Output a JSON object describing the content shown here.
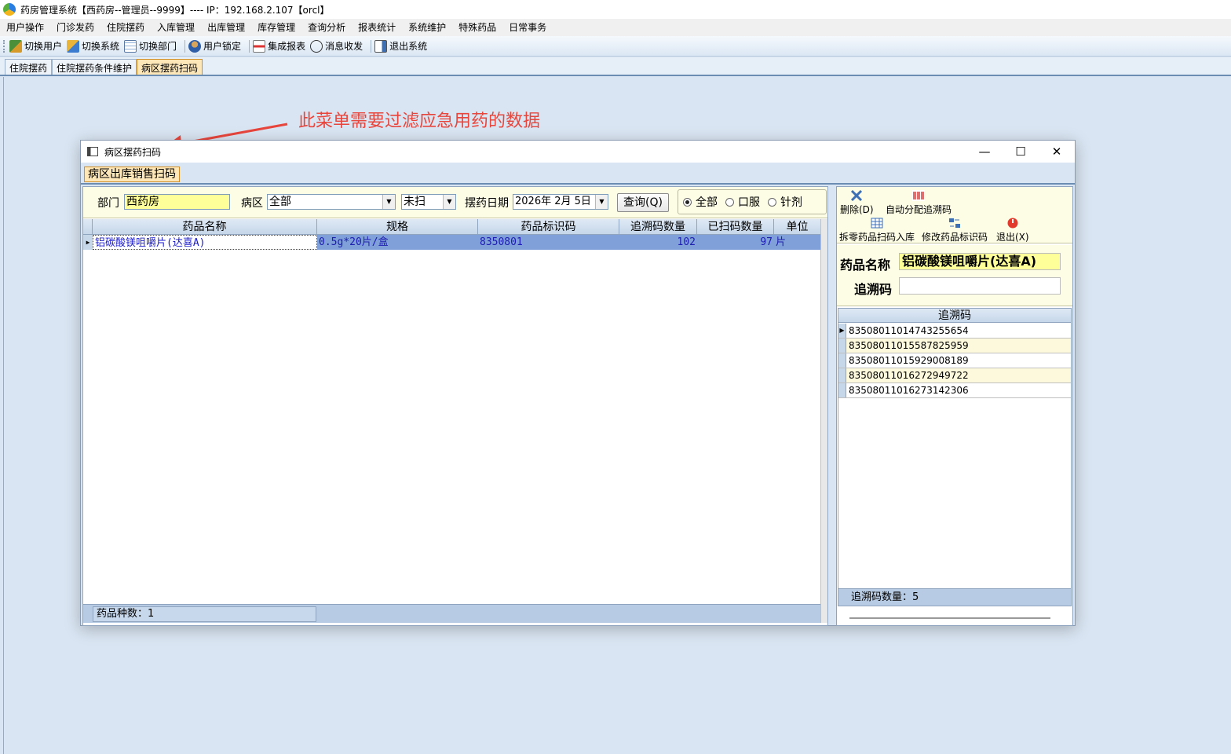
{
  "app": {
    "title": "药房管理系统【西药房--管理员--9999】---- IP：192.168.2.107【orcl】"
  },
  "menu": [
    "用户操作",
    "门诊发药",
    "住院摆药",
    "入库管理",
    "出库管理",
    "库存管理",
    "查询分析",
    "报表统计",
    "系统维护",
    "特殊药品",
    "日常事务"
  ],
  "toolbar": {
    "switch_user": "切换用户",
    "switch_system": "切换系统",
    "switch_dept": "切换部门",
    "lock_user": "用户锁定",
    "integrated_report": "集成报表",
    "messages": "消息收发",
    "exit": "退出系统"
  },
  "tabs": [
    "住院摆药",
    "住院摆药条件维护",
    "病区摆药扫码"
  ],
  "annotation": "此菜单需要过滤应急用药的数据",
  "window": {
    "title": "病区摆药扫码",
    "subtab": "病区出库销售扫码"
  },
  "filters": {
    "dept_label": "部门",
    "dept_value": "西药房",
    "ward_label": "病区",
    "ward_value": "全部",
    "scan_value": "未扫",
    "date_label": "摆药日期",
    "date_value": "2026年  2月  5日",
    "query_button": "查询(Q)",
    "radio_all": "全部",
    "radio_oral": "口服",
    "radio_injection": "针剂"
  },
  "grid": {
    "columns": [
      "药品名称",
      "规格",
      "药品标识码",
      "追溯码数量",
      "已扫码数量",
      "单位"
    ],
    "rows": [
      {
        "name": "铝碳酸镁咀嚼片(达喜A)",
        "spec": "0.5g*20片/盒",
        "code": "8350801",
        "trace_qty": "102",
        "scanned_qty": "97",
        "unit": "片"
      }
    ],
    "footer": "药品种数：1"
  },
  "right": {
    "delete": "删除(D)",
    "auto_assign": "自动分配追溯码",
    "split_scan": "拆零药品扫码入库",
    "modify_code": "修改药品标识码",
    "exit": "退出(X)",
    "drug_name_label": "药品名称",
    "drug_name_value": "铝碳酸镁咀嚼片(达喜A)",
    "trace_label": "追溯码",
    "trace_value": "",
    "codes_header": "追溯码",
    "codes": [
      "83508011014743255654",
      "83508011015587825959",
      "83508011015929008189",
      "83508011016272949722",
      "83508011016273142306"
    ],
    "codes_footer": "追溯码数量：5"
  },
  "colors": {
    "accent_tab": "#fde6b8",
    "selected_row": "#7fa0d8",
    "annotation": "#e8453c",
    "field_yellow": "#ffff99"
  }
}
